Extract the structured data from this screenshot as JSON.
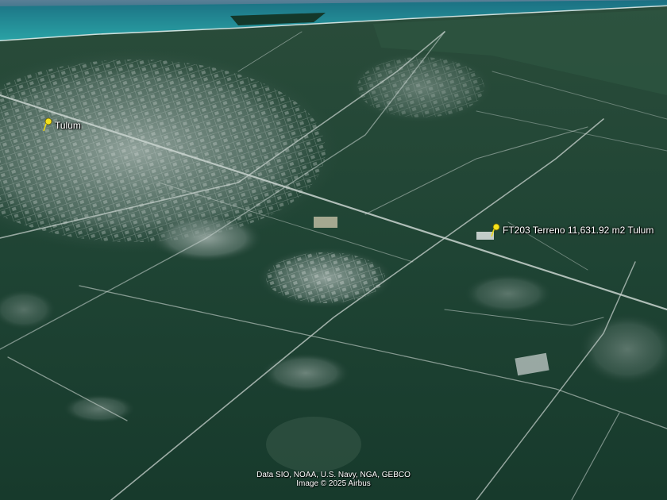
{
  "placemarks": [
    {
      "id": "tulum",
      "label": "Tulum",
      "color": "#f5e21a"
    },
    {
      "id": "ft203",
      "label": "FT203 Terreno 11,631.92 m2 Tulum",
      "color": "#f5e21a"
    }
  ],
  "attribution": {
    "data": "Data SIO, NOAA, U.S. Navy, NGA, GEBCO",
    "image": "Image © 2025 Airbus"
  },
  "colors": {
    "sea": "#1d8a9a",
    "jungle": "#1f4535",
    "urban": "#9aa9a3",
    "roads": "#c9d3cf",
    "pin": "#f5e21a"
  }
}
